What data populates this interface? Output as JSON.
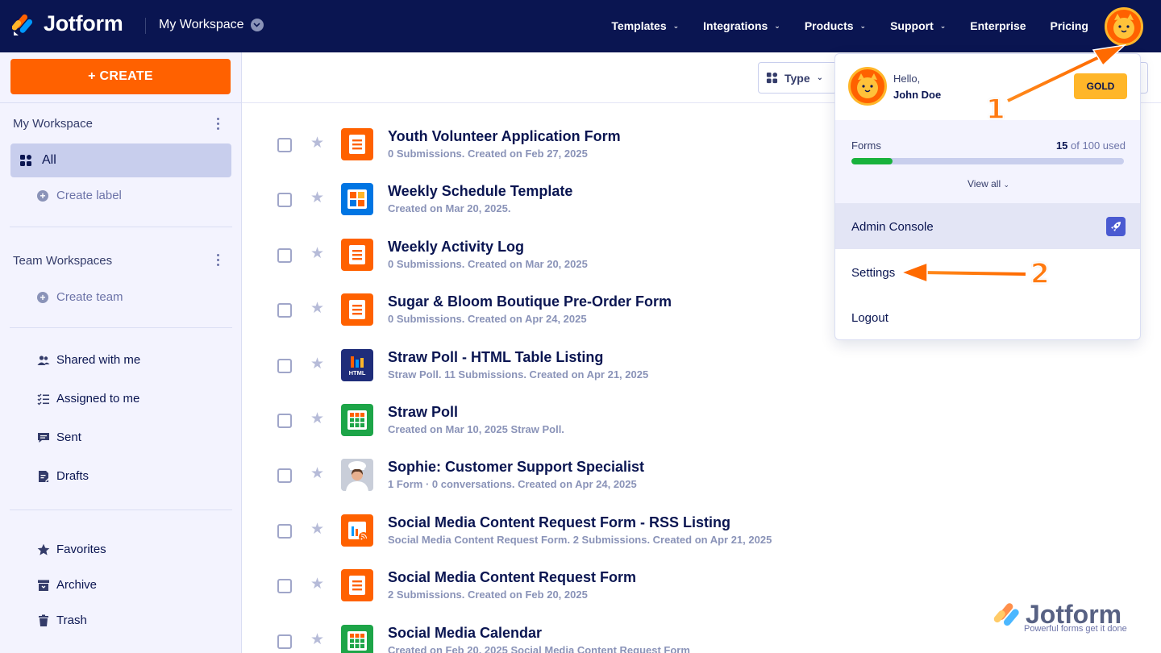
{
  "header": {
    "brand": "Jotform",
    "workspace": "My Workspace",
    "nav": [
      {
        "label": "Templates",
        "has_chevron": true
      },
      {
        "label": "Integrations",
        "has_chevron": true
      },
      {
        "label": "Products",
        "has_chevron": true
      },
      {
        "label": "Support",
        "has_chevron": true
      },
      {
        "label": "Enterprise",
        "has_chevron": false
      },
      {
        "label": "Pricing",
        "has_chevron": false
      }
    ]
  },
  "sidebar": {
    "create_label": "+ CREATE",
    "my_workspace_title": "My Workspace",
    "all_label": "All",
    "create_label_link": "Create label",
    "team_workspaces_title": "Team Workspaces",
    "create_team_link": "Create team",
    "items": [
      {
        "label": "Shared with me",
        "icon": "users-icon"
      },
      {
        "label": "Assigned to me",
        "icon": "checklist-icon"
      },
      {
        "label": "Sent",
        "icon": "message-icon"
      },
      {
        "label": "Drafts",
        "icon": "draft-icon"
      },
      {
        "label": "Favorites",
        "icon": "star-icon"
      },
      {
        "label": "Archive",
        "icon": "archive-icon"
      },
      {
        "label": "Trash",
        "icon": "trash-icon"
      }
    ]
  },
  "toolbar": {
    "type_filter": "Type"
  },
  "forms": [
    {
      "title": "Youth Volunteer Application Form",
      "meta": "0 Submissions. Created on Feb 27, 2025",
      "icon": "form"
    },
    {
      "title": "Weekly Schedule Template",
      "meta": "Created on Mar 20, 2025.",
      "icon": "table"
    },
    {
      "title": "Weekly Activity Log",
      "meta": "0 Submissions. Created on Mar 20, 2025",
      "icon": "form"
    },
    {
      "title": "Sugar & Bloom Boutique Pre-Order Form",
      "meta": "0 Submissions. Created on Apr 24, 2025",
      "icon": "form"
    },
    {
      "title": "Straw Poll - HTML Table Listing",
      "meta": "Straw Poll. 11 Submissions. Created on Apr 21, 2025",
      "icon": "html"
    },
    {
      "title": "Straw Poll",
      "meta": "Created on Mar 10, 2025 Straw Poll.",
      "icon": "sheet"
    },
    {
      "title": "Sophie: Customer Support Specialist",
      "meta": "1 Form · 0 conversations. Created on Apr 24, 2025",
      "icon": "agent"
    },
    {
      "title": "Social Media Content Request Form - RSS Listing",
      "meta": "Social Media Content Request Form. 2 Submissions. Created on Apr 21, 2025",
      "icon": "rss"
    },
    {
      "title": "Social Media Content Request Form",
      "meta": "2 Submissions. Created on Feb 20, 2025",
      "icon": "form"
    },
    {
      "title": "Social Media Calendar",
      "meta": "Created on Feb 20, 2025 Social Media Content Request Form",
      "icon": "sheet"
    }
  ],
  "account_menu": {
    "greeting": "Hello,",
    "user_name": "John Doe",
    "plan_badge": "GOLD",
    "usage_label": "Forms",
    "usage_used": "15",
    "usage_total_text": "of 100 used",
    "usage_fraction": 0.15,
    "view_all": "View all",
    "admin_console": "Admin Console",
    "settings": "Settings",
    "logout": "Logout"
  },
  "callouts": {
    "one": "1",
    "two": "2"
  },
  "watermark": {
    "brand": "Jotform",
    "tagline": "Powerful forms get it done"
  },
  "colors": {
    "navy": "#0a1551",
    "orange": "#ff6100",
    "gold": "#ffb629",
    "green": "#18b23c",
    "sidebar_bg": "#f3f3fe"
  }
}
